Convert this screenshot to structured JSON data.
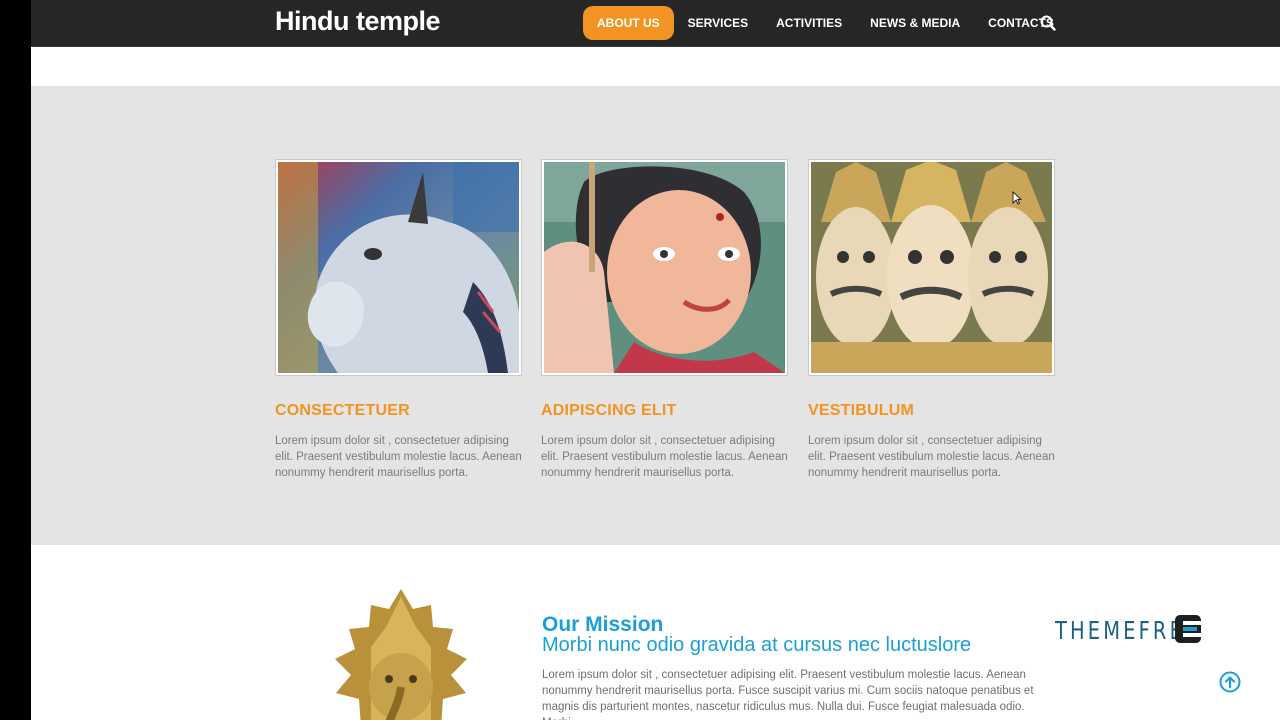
{
  "header": {
    "logo": "Hindu temple",
    "nav": [
      {
        "label": "ABOUT US",
        "active": true
      },
      {
        "label": "SERVICES",
        "active": false
      },
      {
        "label": "ACTIVITIES",
        "active": false
      },
      {
        "label": "NEWS & MEDIA",
        "active": false
      },
      {
        "label": "CONTACTS",
        "active": false
      }
    ],
    "search_icon": "search-icon"
  },
  "features": {
    "cards": [
      {
        "title": "CONSECTETUER",
        "text": "Lorem ipsum dolor sit , consectetuer adipising elit. Praesent vestibulum molestie lacus. Aenean nonummy hendrerit maurisellus porta."
      },
      {
        "title": "ADIPISCING ELIT",
        "text": "Lorem ipsum dolor sit , consectetuer adipising elit. Praesent vestibulum molestie lacus. Aenean nonummy hendrerit maurisellus porta."
      },
      {
        "title": "VESTIBULUM",
        "text": "Lorem ipsum dolor sit , consectetuer adipising elit. Praesent vestibulum molestie lacus. Aenean nonummy hendrerit maurisellus porta."
      }
    ]
  },
  "mission": {
    "title": "Our Mission",
    "subtitle": "Morbi nunc odio gravida at cursus nec luctuslore",
    "body": "Lorem ipsum dolor sit , consectetuer adipising elit. Praesent vestibulum molestie lacus. Aenean nonummy hendrerit maurisellus porta. Fusce suscipit varius mi. Cum sociis natoque penatibus et magnis dis parturient montes, nascetur ridiculus mus. Nulla dui. Fusce feugiat malesuada odio. Morbi"
  },
  "brand": {
    "text": "THEMEFRE"
  },
  "colors": {
    "accent": "#f39322",
    "blue": "#1b9fd8",
    "header_bg": "#262626",
    "section_bg": "#e4e4e4"
  }
}
